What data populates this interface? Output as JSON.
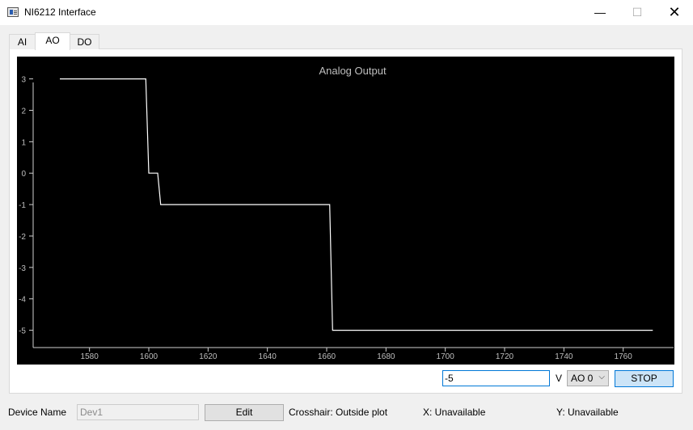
{
  "window": {
    "title": "NI6212 Interface",
    "minimize": "—",
    "maximize": "☐",
    "close": "✕"
  },
  "tabs": [
    {
      "label": "AI"
    },
    {
      "label": "AO",
      "active": true
    },
    {
      "label": "DO"
    }
  ],
  "chart_data": {
    "type": "line",
    "title": "Analog Output",
    "xlabel": "",
    "ylabel": "",
    "xlim": [
      1561,
      1777
    ],
    "ylim": [
      -5.55,
      3.35
    ],
    "xticks": [
      1580,
      1600,
      1620,
      1640,
      1660,
      1680,
      1700,
      1720,
      1740,
      1760
    ],
    "yticks": [
      3,
      2,
      1,
      0,
      -1,
      -2,
      -3,
      -4,
      -5
    ],
    "series": [
      {
        "x": [
          1570,
          1599,
          1600,
          1603,
          1604,
          1661,
          1662,
          1770
        ],
        "y": [
          3,
          3,
          0,
          0,
          -1,
          -1,
          -5,
          -5
        ]
      }
    ],
    "colors": {
      "background": "#000000",
      "line": "#ffffff",
      "axis": "#cfcfcf",
      "text": "#bfbfbf"
    }
  },
  "controls": {
    "output_value": "-5",
    "unit": "V",
    "channel": "AO 0",
    "channel_chevron": "⌵",
    "stop_label": "STOP"
  },
  "status": {
    "device_label": "Device Name",
    "device_value": "Dev1",
    "edit_label": "Edit",
    "crosshair": "Crosshair: Outside plot",
    "x_text": "X: Unavailable",
    "y_text": "Y: Unavailable"
  }
}
